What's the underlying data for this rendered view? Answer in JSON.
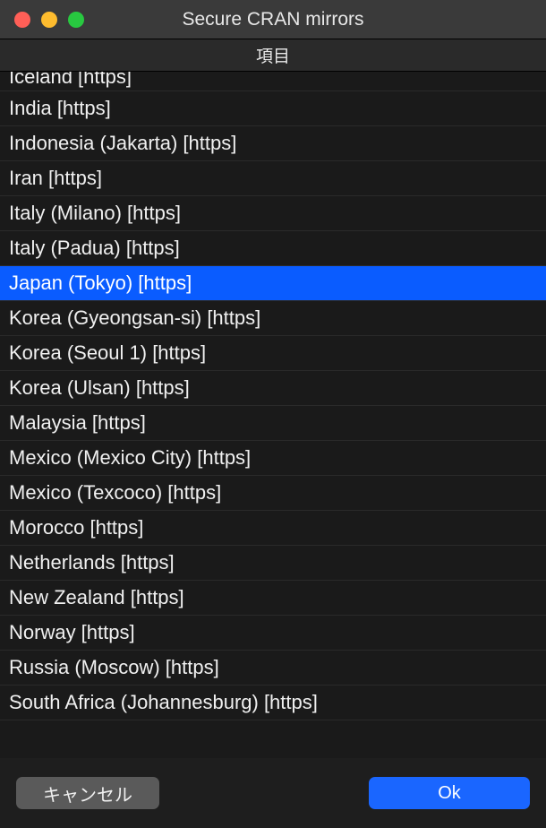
{
  "window": {
    "title": "Secure CRAN mirrors"
  },
  "list": {
    "header": "項目",
    "items": [
      {
        "label": "Iceland [https]",
        "selected": false,
        "partial": true
      },
      {
        "label": "India [https]",
        "selected": false
      },
      {
        "label": "Indonesia (Jakarta) [https]",
        "selected": false
      },
      {
        "label": "Iran [https]",
        "selected": false
      },
      {
        "label": "Italy (Milano) [https]",
        "selected": false
      },
      {
        "label": "Italy (Padua) [https]",
        "selected": false
      },
      {
        "label": "Japan (Tokyo) [https]",
        "selected": true
      },
      {
        "label": "Korea (Gyeongsan-si) [https]",
        "selected": false
      },
      {
        "label": "Korea (Seoul 1) [https]",
        "selected": false
      },
      {
        "label": "Korea (Ulsan) [https]",
        "selected": false
      },
      {
        "label": "Malaysia [https]",
        "selected": false
      },
      {
        "label": "Mexico (Mexico City) [https]",
        "selected": false
      },
      {
        "label": "Mexico (Texcoco) [https]",
        "selected": false
      },
      {
        "label": "Morocco [https]",
        "selected": false
      },
      {
        "label": "Netherlands [https]",
        "selected": false
      },
      {
        "label": "New Zealand [https]",
        "selected": false
      },
      {
        "label": "Norway [https]",
        "selected": false
      },
      {
        "label": "Russia (Moscow) [https]",
        "selected": false
      },
      {
        "label": "South Africa (Johannesburg) [https]",
        "selected": false
      }
    ]
  },
  "buttons": {
    "cancel": "キャンセル",
    "ok": "Ok"
  }
}
